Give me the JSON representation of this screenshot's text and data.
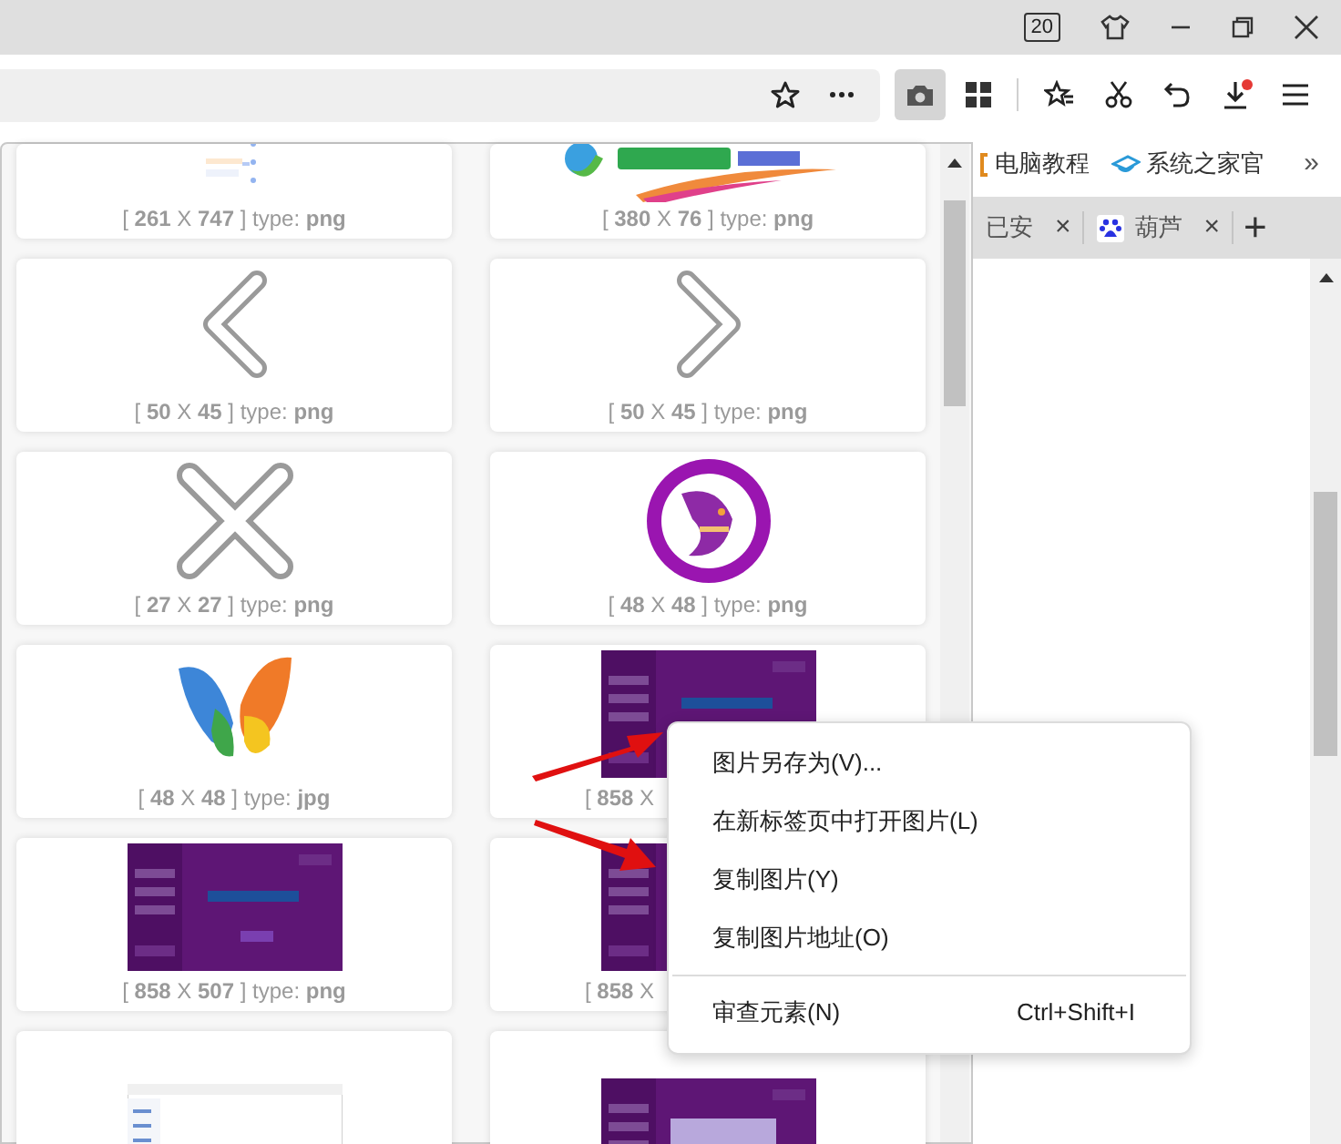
{
  "titlebar": {
    "badge": "20"
  },
  "bookmarks": [
    {
      "label": "电脑教程"
    },
    {
      "label": "系统之家官"
    }
  ],
  "bookmarks_more": "»",
  "tabs": [
    {
      "label": "已安",
      "close": "×"
    },
    {
      "label": "葫芦",
      "close": "×"
    }
  ],
  "new_tab": "+",
  "cards": [
    {
      "kind": "whole",
      "caption": "[ **261** X **747** ] type: **png**"
    },
    {
      "kind": "whole",
      "caption": "[ **380** X **76** ] type: **png**"
    },
    {
      "kind": "whole",
      "caption": "[ **50** X **45** ] type: **png**"
    },
    {
      "kind": "whole",
      "caption": "[ **50** X **45** ] type: **png**"
    },
    {
      "kind": "whole",
      "caption": "[ **27** X **27** ] type: **png**"
    },
    {
      "kind": "whole",
      "caption": "[ **48** X **48** ] type: **png**"
    },
    {
      "kind": "whole",
      "caption": "[ **48** X **48** ] type: **jpg**"
    },
    {
      "kind": "covered",
      "caption": "[ **858** X"
    },
    {
      "kind": "whole",
      "caption": "[ **858** X **507** ] type: **png**"
    },
    {
      "kind": "covered",
      "caption": "[ **858** X"
    },
    {
      "kind": "cut-off"
    },
    {
      "kind": "cut-off"
    }
  ],
  "context_menu": {
    "items": [
      {
        "kind": "item",
        "label": "图片另存为(V)..."
      },
      {
        "kind": "item",
        "label": "在新标签页中打开图片(L)"
      },
      {
        "kind": "item",
        "label": "复制图片(Y)"
      },
      {
        "kind": "item",
        "label": "复制图片地址(O)"
      },
      {
        "kind": "separator"
      },
      {
        "kind": "item",
        "label": "审查元素(N)",
        "shortcut": "Ctrl+Shift+I"
      }
    ]
  }
}
